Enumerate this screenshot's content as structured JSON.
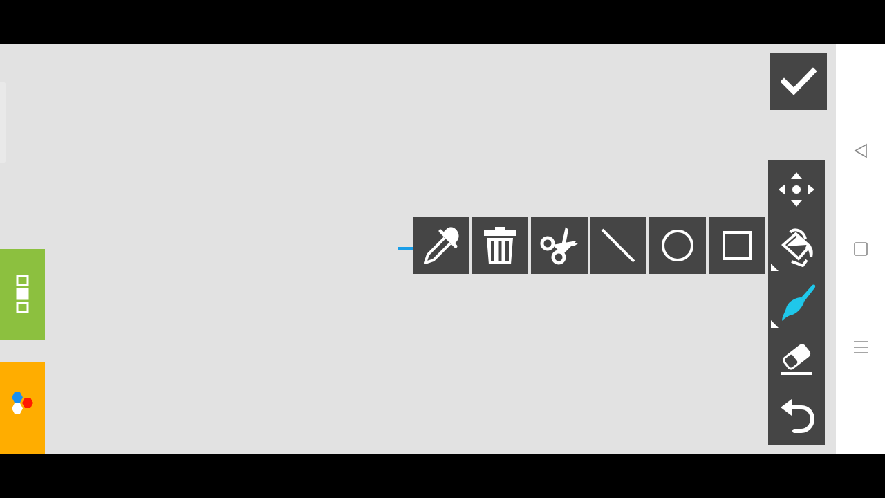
{
  "colors": {
    "canvas_background": "#e2e2e2",
    "toolbar_background": "#454545",
    "layers_tab": "#8cc03f",
    "colors_tab": "#ffad00",
    "brush_active": "#1fc7ea",
    "stroke_preview": "#1a9ee8"
  },
  "navigation_bar": {
    "buttons": [
      "back-icon",
      "home-icon",
      "menu-icon"
    ]
  },
  "side_tabs": [
    {
      "name": "layers",
      "icon": "layers-icon"
    },
    {
      "name": "colors",
      "icon": "color-palette-icon"
    }
  ],
  "confirm": {
    "icon": "checkmark-icon"
  },
  "vertical_toolbar": [
    {
      "tool": "move",
      "icon": "move-icon"
    },
    {
      "tool": "fill",
      "icon": "paint-bucket-icon",
      "has_submenu": true
    },
    {
      "tool": "brush",
      "icon": "brush-icon",
      "has_submenu": true,
      "active": true
    },
    {
      "tool": "eraser",
      "icon": "eraser-icon"
    },
    {
      "tool": "undo",
      "icon": "undo-icon"
    }
  ],
  "horizontal_toolbar": [
    {
      "tool": "eyedropper",
      "icon": "eyedropper-icon"
    },
    {
      "tool": "delete",
      "icon": "trash-icon"
    },
    {
      "tool": "cut",
      "icon": "scissors-icon"
    },
    {
      "tool": "line",
      "icon": "line-icon"
    },
    {
      "tool": "circle",
      "icon": "circle-icon"
    },
    {
      "tool": "rectangle",
      "icon": "rectangle-icon"
    }
  ]
}
